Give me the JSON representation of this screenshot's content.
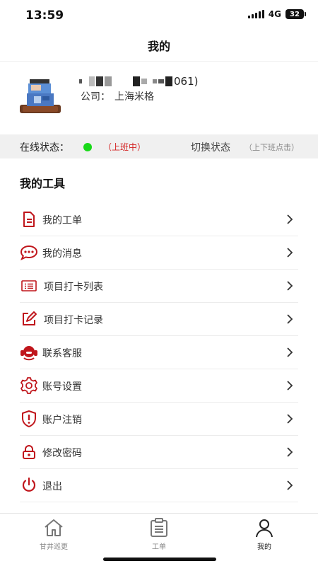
{
  "status_bar": {
    "time": "13:59",
    "network": "4G",
    "battery": "32"
  },
  "nav": {
    "title": "我的"
  },
  "profile": {
    "name_visible_tail": "061)",
    "company_label": "公司：",
    "company_name": "上海米格"
  },
  "online": {
    "label": "在线状态：",
    "state": "（上班中）",
    "switch_label": "切换状态",
    "switch_hint": "（上下班点击）",
    "dot_color": "#19d919"
  },
  "tools": {
    "title": "我的工具",
    "items": [
      {
        "label": "我的工单",
        "icon": "document-icon"
      },
      {
        "label": "我的消息",
        "icon": "chat-bubble-icon"
      },
      {
        "label": "项目打卡列表",
        "icon": "list-icon"
      },
      {
        "label": "项目打卡记录",
        "icon": "edit-icon"
      },
      {
        "label": "联系客服",
        "icon": "headset-icon"
      },
      {
        "label": "账号设置",
        "icon": "gear-icon"
      },
      {
        "label": "账户注销",
        "icon": "shield-alert-icon"
      },
      {
        "label": "修改密码",
        "icon": "lock-icon"
      },
      {
        "label": "退出",
        "icon": "power-icon"
      }
    ]
  },
  "tabs": [
    {
      "label": "甘井巡更",
      "icon": "home-icon"
    },
    {
      "label": "工单",
      "icon": "clipboard-icon"
    },
    {
      "label": "我的",
      "icon": "user-icon",
      "active": true
    }
  ],
  "colors": {
    "accent": "#c0161c",
    "online": "#19d919",
    "state_text": "#d32020"
  }
}
